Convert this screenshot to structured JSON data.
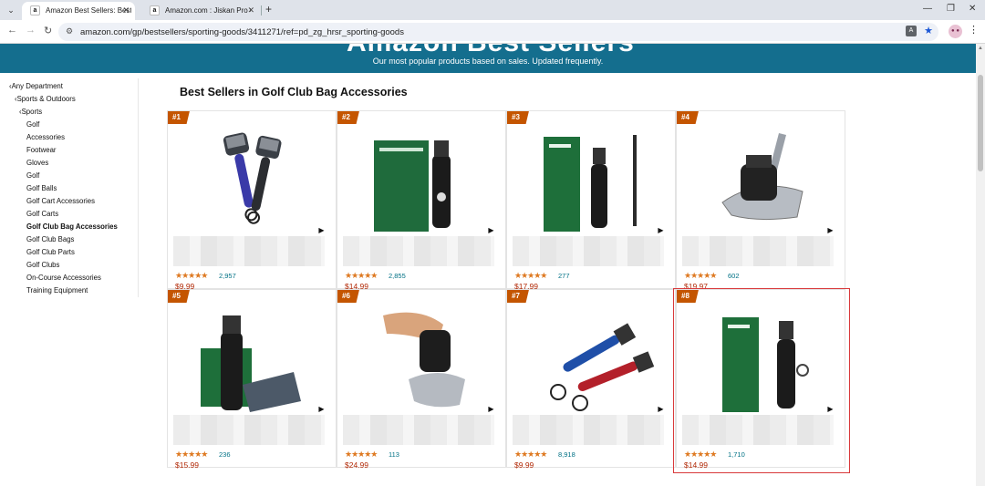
{
  "browser": {
    "tabs": [
      {
        "title": "Amazon Best Sellers: Best Go…",
        "favicon": "a",
        "active": true
      },
      {
        "title": "Amazon.com : Jiskan Pro Golf…",
        "favicon": "a",
        "active": false
      }
    ],
    "new_tab_label": "+",
    "url": "amazon.com/gp/bestsellers/sporting-goods/3411271/ref=pd_zg_hrsr_sporting-goods",
    "profile_initials": "● ●",
    "icons": [
      "tab-list-icon",
      "back-icon",
      "forward-icon",
      "reload-icon",
      "tune-icon",
      "translate-icon",
      "star-icon",
      "menu-icon",
      "minimize-icon",
      "maximize-icon",
      "close-icon"
    ]
  },
  "banner": {
    "ghost_title": "Amazon Best Sellers",
    "subtitle": "Our most popular products based on sales. Updated frequently."
  },
  "sidebar": {
    "items": [
      {
        "label": "‹Any Department",
        "level": 0,
        "bold": false
      },
      {
        "label": "‹Sports & Outdoors",
        "level": 1,
        "bold": false
      },
      {
        "label": "‹Sports",
        "level": 2,
        "bold": false
      },
      {
        "label": "Golf",
        "level": 3,
        "bold": false
      },
      {
        "label": "Accessories",
        "level": 3,
        "bold": false
      },
      {
        "label": "Footwear",
        "level": 3,
        "bold": false
      },
      {
        "label": "Gloves",
        "level": 3,
        "bold": false
      },
      {
        "label": "Golf",
        "level": 3,
        "bold": false
      },
      {
        "label": "Golf Balls",
        "level": 3,
        "bold": false
      },
      {
        "label": "Golf Cart Accessories",
        "level": 3,
        "bold": false
      },
      {
        "label": "Golf Carts",
        "level": 3,
        "bold": false
      },
      {
        "label": "Golf Club Bag Accessories",
        "level": 3,
        "bold": true
      },
      {
        "label": "Golf Club Bags",
        "level": 3,
        "bold": false
      },
      {
        "label": "Golf Club Parts",
        "level": 3,
        "bold": false
      },
      {
        "label": "Golf Clubs",
        "level": 3,
        "bold": false
      },
      {
        "label": "On-Course Accessories",
        "level": 3,
        "bold": false
      },
      {
        "label": "Training Equipment",
        "level": 3,
        "bold": false
      }
    ]
  },
  "main": {
    "title": "Best Sellers in Golf Club Bag Accessories",
    "products": [
      {
        "rank": "#1",
        "stars": "★★★★★",
        "rating_count": "2,957",
        "price": "$9.99",
        "image": "dual-brush-blue-black"
      },
      {
        "rank": "#2",
        "stars": "★★★★★",
        "rating_count": "2,855",
        "price": "$14.99",
        "image": "green-box-brush"
      },
      {
        "rank": "#3",
        "stars": "★★★★★",
        "rating_count": "277",
        "price": "$17.99",
        "image": "jiskan-box-brush-telescopic"
      },
      {
        "rank": "#4",
        "stars": "★★★★★",
        "rating_count": "602",
        "price": "$19.97",
        "image": "brush-on-club-head"
      },
      {
        "rank": "#5",
        "stars": "★★★★★",
        "rating_count": "236",
        "price": "$15.99",
        "image": "brush-with-box-and-towel"
      },
      {
        "rank": "#6",
        "stars": "★★★★★",
        "rating_count": "113",
        "price": "$24.99",
        "image": "hand-held-brush-club"
      },
      {
        "rank": "#7",
        "stars": "★★★★★",
        "rating_count": "8,918",
        "price": "$9.99",
        "image": "dual-brush-blue-red"
      },
      {
        "rank": "#8",
        "stars": "★★★★★",
        "rating_count": "1,710",
        "price": "$14.99",
        "image": "jiskan-box-brush",
        "highlighted": true
      }
    ],
    "play_glyph": "▶",
    "highlight_color": "#d9393b"
  },
  "colors": {
    "banner": "#146e8e",
    "rank_badge": "#c45500",
    "stars": "#de7921",
    "link": "#007185",
    "price": "#b12704"
  }
}
